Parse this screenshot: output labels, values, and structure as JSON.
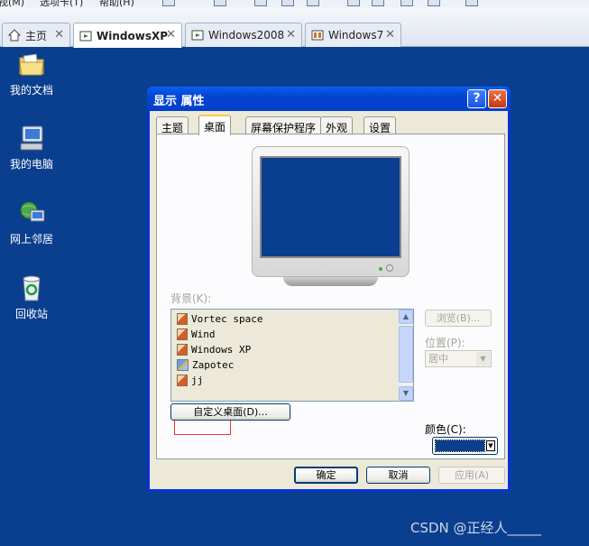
{
  "host_menu": {
    "item1": "视(M)",
    "item2": "选项卡(T)",
    "item3": "帮助(H)"
  },
  "tabs": [
    {
      "label": "主页",
      "icon": "home-icon"
    },
    {
      "label": "WindowsXP",
      "icon": "vm-icon",
      "active": true
    },
    {
      "label": "Windows2008",
      "icon": "vm-icon"
    },
    {
      "label": "Windows7",
      "icon": "vm-icon"
    }
  ],
  "close_glyph": "✕",
  "desktop_icons": [
    {
      "label": "我的文档",
      "icon": "folder-icon"
    },
    {
      "label": "我的电脑",
      "icon": "computer-icon"
    },
    {
      "label": "网上邻居",
      "icon": "network-icon"
    },
    {
      "label": "回收站",
      "icon": "recycle-bin-icon"
    }
  ],
  "dialog": {
    "title": "显示 属性",
    "help": "?",
    "close": "✕",
    "tabs": [
      "主题",
      "桌面",
      "屏幕保护程序",
      "外观",
      "设置"
    ],
    "active_tab": "桌面",
    "background_label": "背景(K):",
    "background_items": [
      "Vortec space",
      "Wind",
      "Windows XP",
      "Zapotec",
      "jj"
    ],
    "browse_button": "浏览(B)...",
    "position_label": "位置(P):",
    "position_value": "居中",
    "color_label": "颜色(C):",
    "color_value": "#0a3f8f",
    "customize_button": "自定义桌面(D)...",
    "ok_button": "确定",
    "cancel_button": "取消",
    "apply_button": "应用(A)"
  },
  "watermark": "CSDN @正经人_____",
  "colors": {
    "desktop": "#0a3f8f",
    "titlebar": "#0544d3",
    "dialog_face": "#ece9d8",
    "highlight": "#e33333"
  }
}
